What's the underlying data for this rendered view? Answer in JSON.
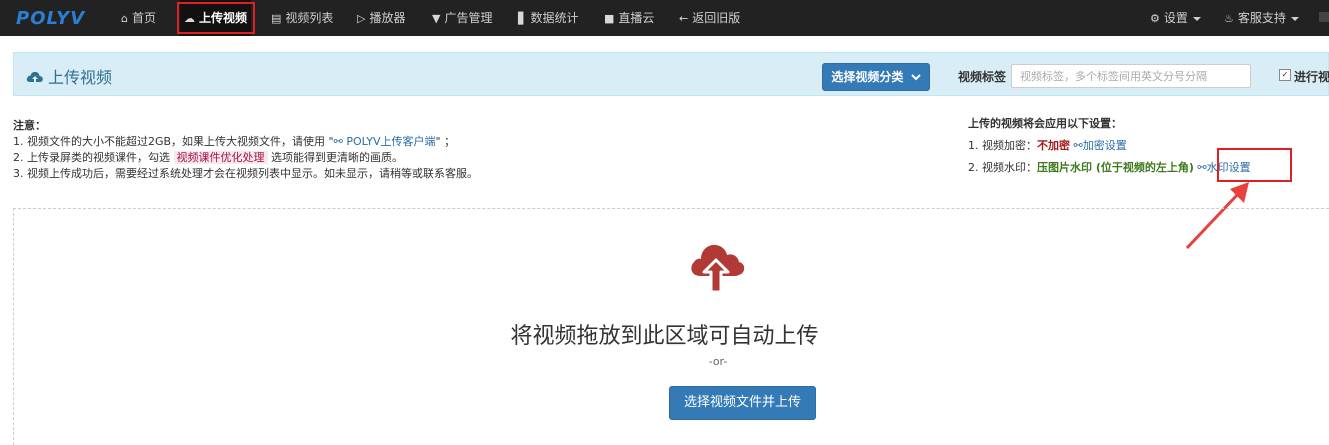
{
  "navbar": {
    "logo": "POLYV",
    "items": [
      {
        "icon": "home-icon",
        "label": "首页"
      },
      {
        "icon": "cloud-upload-icon",
        "label": "上传视频"
      },
      {
        "icon": "film-icon",
        "label": "视频列表"
      },
      {
        "icon": "play-circle-icon",
        "label": "播放器"
      },
      {
        "icon": "filter-icon",
        "label": "广告管理"
      },
      {
        "icon": "bar-chart-icon",
        "label": "数据统计"
      },
      {
        "icon": "video-camera-icon",
        "label": "直播云"
      },
      {
        "icon": "arrow-left-icon",
        "label": "返回旧版"
      }
    ],
    "active": "上传视频",
    "settings_label": "设置",
    "support_label": "客服支持"
  },
  "panel": {
    "title": "上传视频",
    "category_button": "选择视频分类",
    "tag_label": "视频标签",
    "tag_placeholder": "视频标签，多个标签间用英文分号分隔",
    "convert_label": "进行视"
  },
  "notes": {
    "title": "注意：",
    "line1_pre": "1. 视频文件的大小不能超过2GB，如果上传大视频文件，请使用 \"",
    "line1_link": "POLYV上传客户端",
    "line1_post": "\" ；",
    "line2_pre": "2. 上传录屏类的视频课件，勾选",
    "line2_highlight": "视频课件优化处理",
    "line2_post": "选项能得到更清晰的画质。",
    "line3": "3. 视频上传成功后，需要经过系统处理才会在视频列表中显示。如未显示，请稍等或联系客服。"
  },
  "settings": {
    "title": "上传的视频将会应用以下设置：",
    "encrypt_label": "1. 视频加密：",
    "encrypt_value": "不加密",
    "encrypt_link": "加密设置",
    "watermark_label": "2. 视频水印：",
    "watermark_value": "压图片水印 (位于视频的左上角)",
    "watermark_link": "水印设置"
  },
  "dropzone": {
    "text": "将视频拖放到此区域可自动上传",
    "or": "-or-",
    "button": "选择视频文件并上传"
  },
  "colors": {
    "navbar_bg": "#222222",
    "primary": "#337ab7",
    "panel_bg": "#d9edf7",
    "highlight_red": "#e02020",
    "upload_icon": "#b23a36"
  }
}
